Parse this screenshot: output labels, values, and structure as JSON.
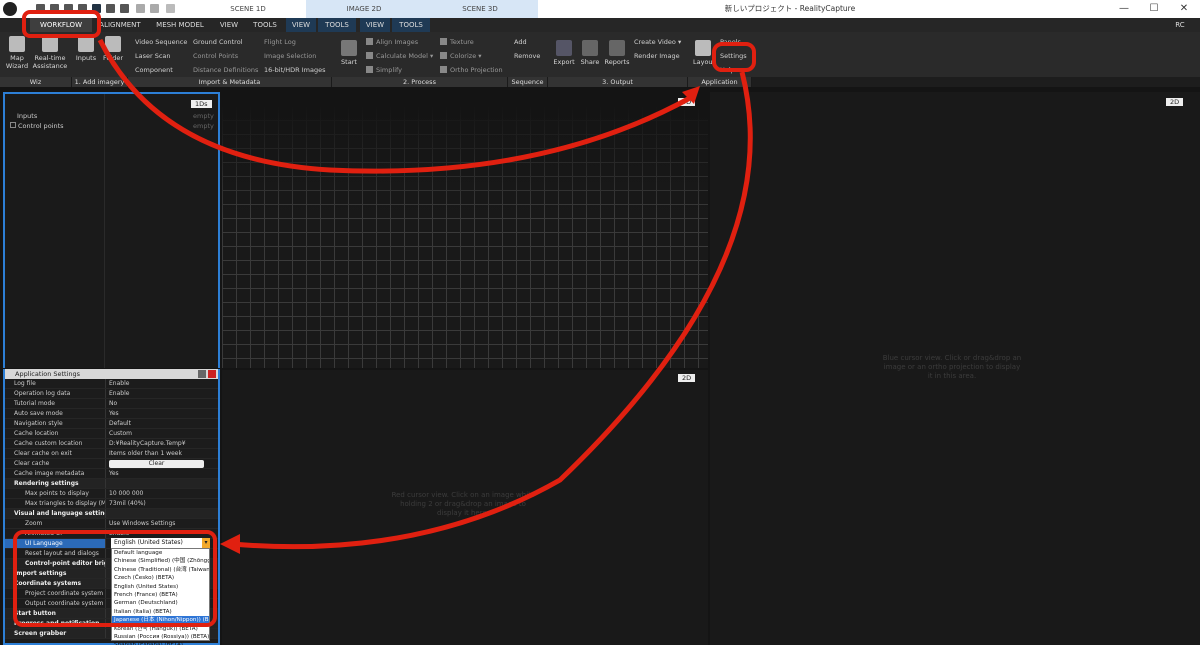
{
  "titlebar": {
    "scene_tabs": [
      "SCENE 1D",
      "IMAGE 2D",
      "SCENE 3D"
    ],
    "window_title": "新しいプロジェクト - RealityCapture",
    "window_controls": [
      "—",
      "☐",
      "✕"
    ],
    "account": "RC"
  },
  "menu": {
    "tabs": [
      "WORKFLOW",
      "ALIGNMENT",
      "MESH MODEL",
      "VIEW",
      "TOOLS",
      "VIEW",
      "TOOLS",
      "VIEW",
      "TOOLS"
    ]
  },
  "ribbon": {
    "wiz": {
      "map_wizard": "Map Wizard",
      "realtime": "Real-time Assistance"
    },
    "add_imagery": {
      "inputs": "Inputs",
      "folder": "Folder"
    },
    "import": {
      "col1": [
        "Video Sequence",
        "Laser Scan",
        "Component"
      ],
      "col2": [
        "Ground Control",
        "Control Points",
        "Distance Definitions"
      ],
      "col3": [
        "Flight Log",
        "Image Selection",
        "16-bit/HDR Images"
      ]
    },
    "process": {
      "start": "Start",
      "col1": [
        "Align Images",
        "Calculate Model",
        "Simplify"
      ],
      "col2": [
        "Texture",
        "Colorize",
        "Ortho Projection"
      ]
    },
    "sequence": {
      "add": "Add",
      "remove": "Remove"
    },
    "output": {
      "export": "Export",
      "share": "Share",
      "reports": "Reports",
      "col": [
        "Create Video",
        "Render Image"
      ]
    },
    "application": {
      "layout": "Layout",
      "panels": "Panels",
      "settings": "Settings",
      "help": "Help"
    },
    "groups": [
      "Wiz",
      "1. Add imagery",
      "Import & Metadata",
      "2. Process",
      "Sequence",
      "3. Output",
      "Application"
    ]
  },
  "panels": {
    "tree": {
      "inputs": "Inputs",
      "control_points": "Control points"
    },
    "tag_1ds": "1Ds",
    "empty1": "empty",
    "empty2": "empty",
    "tag_3d": "3D",
    "tag_2d_top": "2D",
    "tag_2d_mid": "2D",
    "hint_right": "Blue cursor view. Click or drag&drop an image or an ortho projection to display it in this area.",
    "hint_mid": "Red cursor view. Click on an image while holding 2 or drag&drop an image to display it here."
  },
  "settings": {
    "title": "Application Settings",
    "rows": [
      {
        "k": "Log file",
        "v": "Enable"
      },
      {
        "k": "Operation log data",
        "v": "Enable"
      },
      {
        "k": "Tutorial mode",
        "v": "No"
      },
      {
        "k": "Auto save mode",
        "v": "Yes"
      },
      {
        "k": "Navigation style",
        "v": "Default"
      },
      {
        "k": "Cache location",
        "v": "Custom"
      },
      {
        "k": "Cache custom location",
        "v": "D:¥RealityCapture.Temp¥"
      },
      {
        "k": "Clear cache on exit",
        "v": "Items older than 1 week"
      }
    ],
    "clear_cache": {
      "k": "Clear cache",
      "btn": "Clear"
    },
    "cache_meta": {
      "k": "Cache image metadata",
      "v": "Yes"
    },
    "rendering": "Rendering settings",
    "render_rows": [
      {
        "k": "Max points to display",
        "v": "10 000 000"
      },
      {
        "k": "Max triangles to display (Ma...",
        "v": "73mil (40%)"
      }
    ],
    "visual": "Visual and language settings",
    "zoom": {
      "k": "Zoom",
      "v": "Use Windows Settings"
    },
    "animated": {
      "k": "Animated UI",
      "v": "Enable"
    },
    "ui_language": {
      "k": "UI Language",
      "v": "English (United States)"
    },
    "reset": {
      "k": "Reset layout and dialogs"
    },
    "cp_editor": "Control-point editor brig",
    "import_settings": "Import settings",
    "coordinate": "Coordinate systems",
    "project_cs": "Project coordinate system",
    "output_cs": "Output coordinate system",
    "start_button": "Start button",
    "progress": "Progress and notification",
    "screen_grabber": "Screen grabber",
    "languages": [
      "Default language",
      "Chinese (Simplified) (中国 (Zhōngguó))",
      "Chinese (Traditional) (台湾 (Taiwan))",
      "Czech (Česko) (BETA)",
      "English (United States)",
      "French (France) (BETA)",
      "German (Deutschland)",
      "Italian (Italia) (BETA)",
      "Japanese (日本 (Nihon/Nippon)) (BETA)",
      "Korean (한국 (Hanguk)) (BETA)",
      "Russian (Россия (Rossiya)) (BETA)",
      "Spanish (España) (BETA)"
    ],
    "selected_language_index": 8
  },
  "colors": {
    "annotation": "#e02010",
    "accent": "#2d7fd6",
    "highlight": "#f3a92b"
  }
}
